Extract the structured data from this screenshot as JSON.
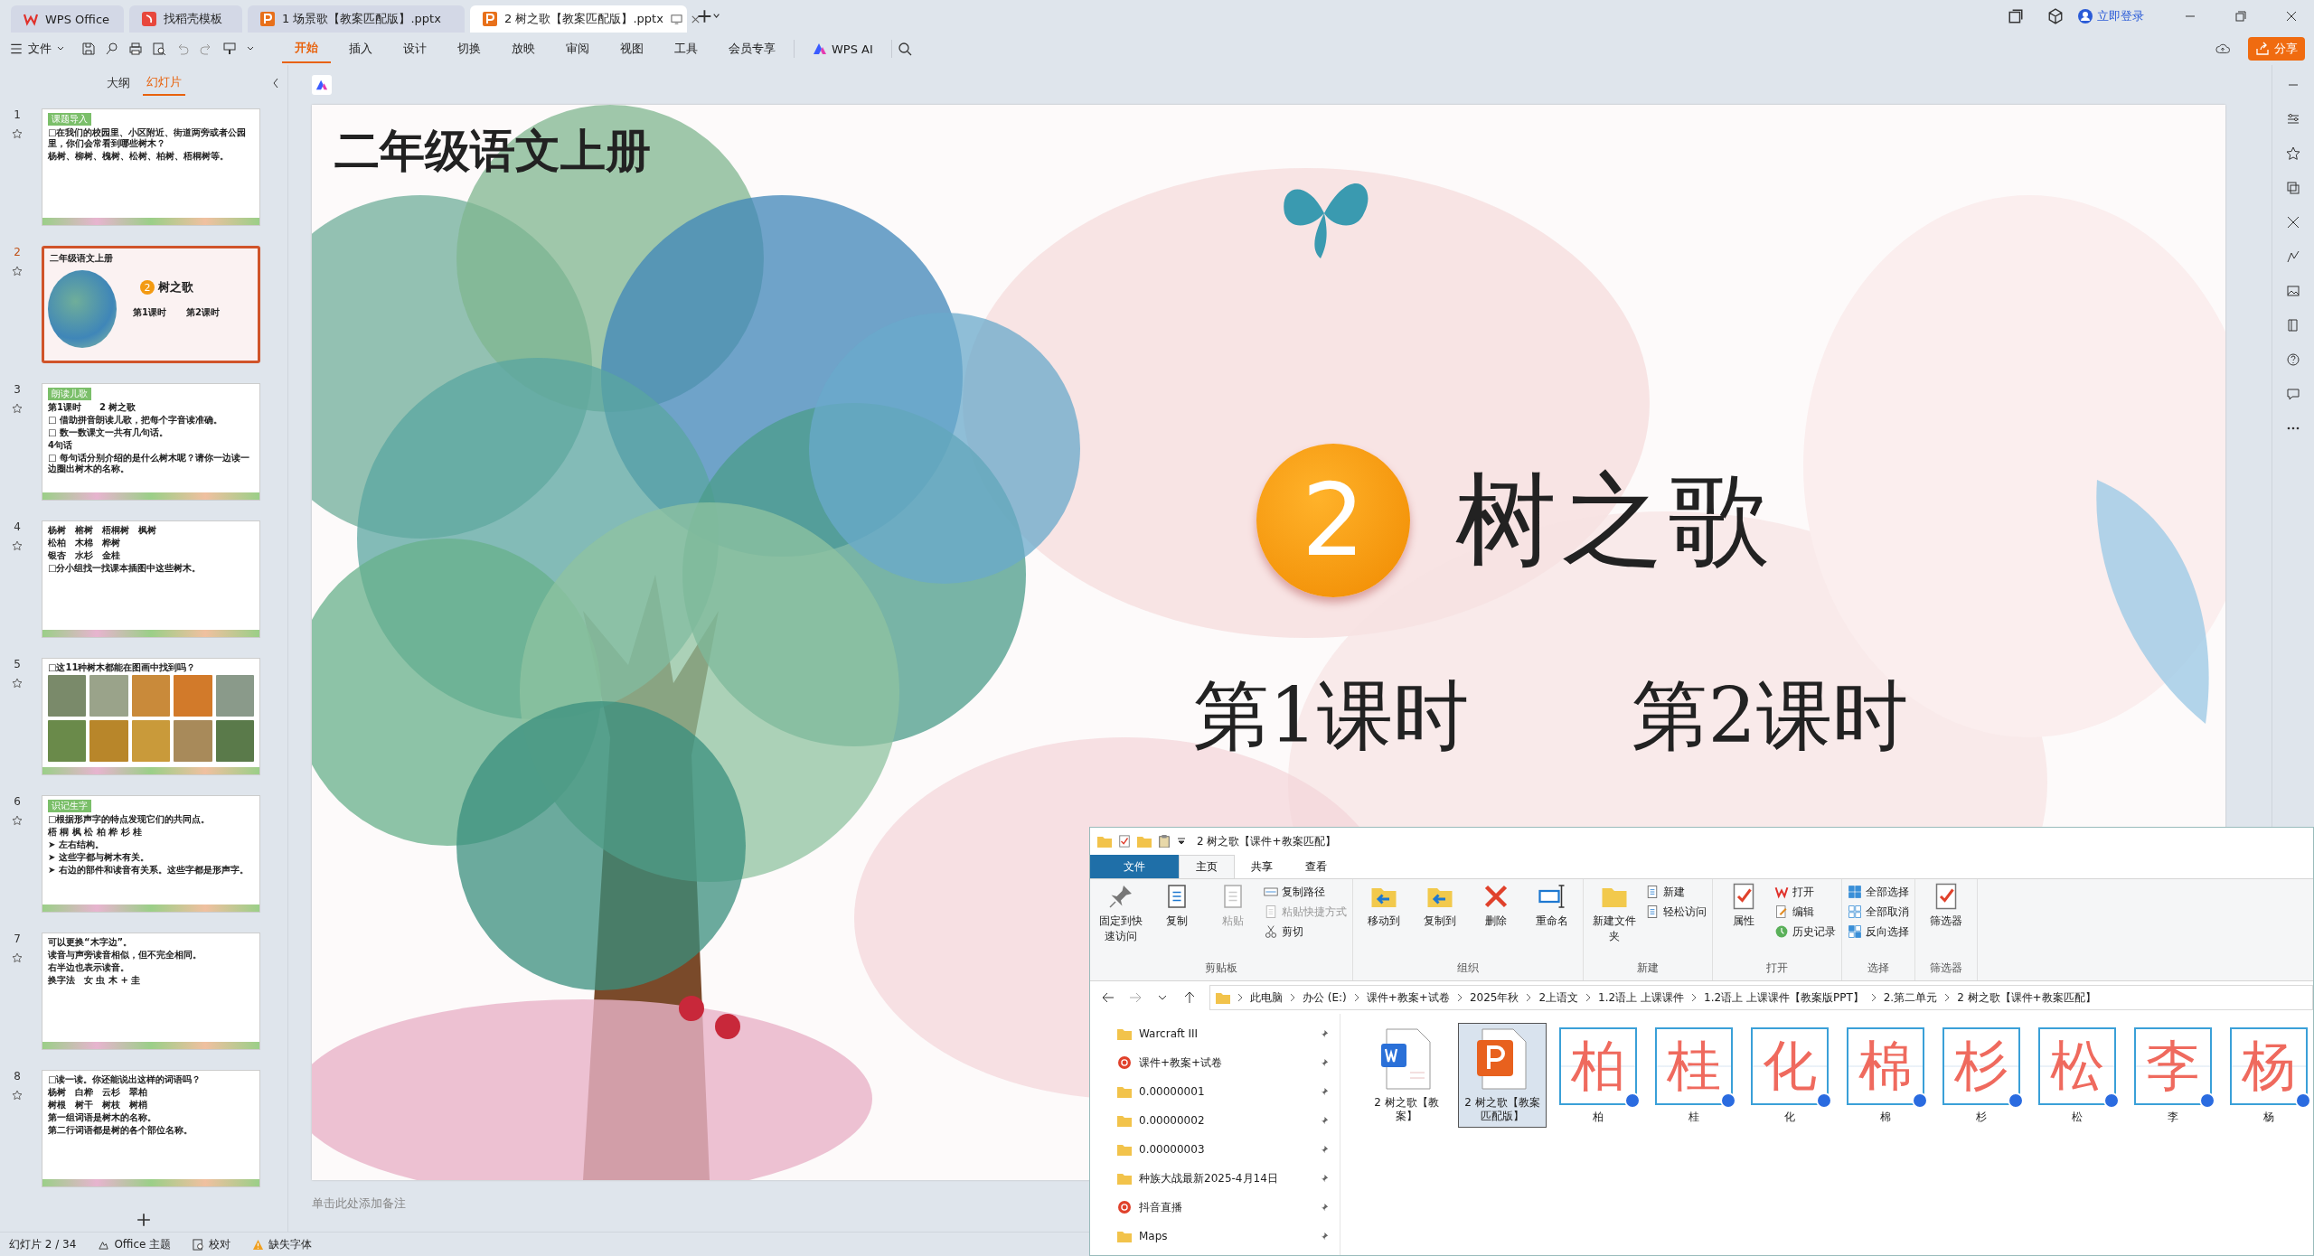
{
  "window_tabs": [
    {
      "label": "WPS Office",
      "kind": "home",
      "selected": false
    },
    {
      "label": "找稻壳模板",
      "kind": "template",
      "selected": false
    },
    {
      "label": "1 场景歌【教案匹配版】.pptx",
      "kind": "doc",
      "selected": false
    },
    {
      "label": "2 树之歌【教案匹配版】.pptx",
      "kind": "doc",
      "selected": true
    }
  ],
  "login": "立即登录",
  "menu": {
    "file": "文件",
    "tabs": [
      {
        "label": "开始",
        "selected": true
      },
      {
        "label": "插入",
        "selected": false
      },
      {
        "label": "设计",
        "selected": false
      },
      {
        "label": "切换",
        "selected": false
      },
      {
        "label": "放映",
        "selected": false
      },
      {
        "label": "审阅",
        "selected": false
      },
      {
        "label": "视图",
        "selected": false
      },
      {
        "label": "工具",
        "selected": false
      },
      {
        "label": "会员专享",
        "selected": false
      }
    ],
    "ai": "WPS AI",
    "share": "分享"
  },
  "panel_tabs": [
    {
      "label": "大纲",
      "selected": false
    },
    {
      "label": "幻灯片",
      "selected": true
    }
  ],
  "thumbnails": [
    {
      "number": "1",
      "kind": "text",
      "selected": false,
      "tag": "课题导入",
      "lines": [
        "□在我们的校园里、小区附近、街道两旁或者公园里，你们会常看到哪些树木？",
        "杨树、柳树、槐树、松树、柏树、梧桐树等。"
      ]
    },
    {
      "number": "2",
      "kind": "title",
      "selected": true,
      "lines": [
        "二年级语文上册",
        "2",
        "树之歌",
        "第1课时",
        "第2课时"
      ]
    },
    {
      "number": "3",
      "kind": "text",
      "selected": false,
      "tag": "朗读儿歌",
      "lines": [
        "第1课时　　2 树之歌",
        "□ 借助拼音朗读儿歌，把每个字音读准确。",
        "□ 数一数课文一共有几句话。",
        "4句话",
        "□ 每句话分别介绍的是什么树木呢？请你一边读一边圈出树木的名称。"
      ]
    },
    {
      "number": "4",
      "kind": "text",
      "selected": false,
      "lines": [
        "杨树　榕树　梧桐树　枫树",
        "松柏　木棉　桦树",
        "银杏　水杉　金桂",
        "□分小组找一找课本插图中这些树木。"
      ]
    },
    {
      "number": "5",
      "kind": "photos",
      "selected": false,
      "lines": [
        "□这11种树木都能在图画中找到吗？"
      ]
    },
    {
      "number": "6",
      "kind": "text",
      "selected": false,
      "tag": "识记生字",
      "lines": [
        "□根据形声字的特点发现它们的共同点。",
        "梧 桐 枫 松 柏 桦 杉 桂",
        "➤ 左右结构。",
        "➤ 这些字都与树木有关。",
        "➤ 右边的部件和读音有关系。这些字都是形声字。"
      ]
    },
    {
      "number": "7",
      "kind": "text",
      "selected": false,
      "lines": [
        "可以更换“木字边”。",
        "读音与声旁读音相似，但不完全相同。",
        "右半边也表示读音。",
        "换字法　女 虫 木 + 圭"
      ]
    },
    {
      "number": "8",
      "kind": "text",
      "selected": false,
      "lines": [
        "□读一读。你还能说出这样的词语吗？",
        "杨树　白桦　云杉　翠柏",
        "树根　树干　树枝　树梢",
        "第一组词语是树木的名称。",
        "第二行词语都是树的各个部位名称。"
      ]
    }
  ],
  "slide": {
    "subtitle": "二年级语文上册",
    "number": "2",
    "title": "树之歌",
    "lessons": [
      "第1课时",
      "第2课时"
    ]
  },
  "notes_placeholder": "单击此处添加备注",
  "status_bar": {
    "slide": "幻灯片 2 / 34",
    "theme": "Office 主题",
    "proof": "校对",
    "fonts": "缺失字体"
  },
  "explorer": {
    "title": "2 树之歌【课件+教案匹配】",
    "tabs": [
      {
        "label": "文件",
        "kind": "file",
        "selected": false
      },
      {
        "label": "主页",
        "kind": "tab",
        "selected": true
      },
      {
        "label": "共享",
        "kind": "tab",
        "selected": false
      },
      {
        "label": "查看",
        "kind": "tab",
        "selected": false
      }
    ],
    "groups": [
      {
        "name": "剪贴板",
        "items": [
          {
            "label": "固定到快速访问",
            "kind": "big",
            "disabled": false
          },
          {
            "label": "复制",
            "kind": "big",
            "disabled": false
          },
          {
            "label": "粘贴",
            "kind": "big",
            "disabled": true
          },
          {
            "label": "复制路径",
            "kind": "small",
            "disabled": false
          },
          {
            "label": "粘贴快捷方式",
            "kind": "small",
            "disabled": true
          },
          {
            "label": "剪切",
            "kind": "small",
            "disabled": false
          }
        ]
      },
      {
        "name": "组织",
        "items": [
          {
            "label": "移动到",
            "kind": "big",
            "disabled": false
          },
          {
            "label": "复制到",
            "kind": "big",
            "disabled": false
          },
          {
            "label": "删除",
            "kind": "big",
            "disabled": false
          },
          {
            "label": "重命名",
            "kind": "big",
            "disabled": false
          }
        ]
      },
      {
        "name": "新建",
        "items": [
          {
            "label": "新建文件夹",
            "kind": "big",
            "disabled": false
          },
          {
            "label": "新建",
            "kind": "small",
            "disabled": false
          },
          {
            "label": "轻松访问",
            "kind": "small",
            "disabled": false
          }
        ]
      },
      {
        "name": "打开",
        "items": [
          {
            "label": "属性",
            "kind": "big",
            "disabled": false
          },
          {
            "label": "打开",
            "kind": "small",
            "disabled": false
          },
          {
            "label": "编辑",
            "kind": "small",
            "disabled": false
          },
          {
            "label": "历史记录",
            "kind": "small",
            "disabled": false
          }
        ]
      },
      {
        "name": "选择",
        "items": [
          {
            "label": "全部选择",
            "kind": "small",
            "disabled": false
          },
          {
            "label": "全部取消",
            "kind": "small",
            "disabled": false
          },
          {
            "label": "反向选择",
            "kind": "small",
            "disabled": false
          }
        ]
      },
      {
        "name": "筛选器",
        "items": [
          {
            "label": "筛选器",
            "kind": "big",
            "disabled": false
          }
        ]
      }
    ],
    "breadcrumb": [
      "此电脑",
      "办公 (E:)",
      "课件+教案+试卷",
      "2025年秋",
      "2上语文",
      "1.2语上 上课课件",
      "1.2语上 上课课件【教案版PPT】",
      "2.第二单元",
      "2 树之歌【课件+教案匹配】"
    ],
    "nav": [
      {
        "label": "Warcraft III",
        "kind": "folder"
      },
      {
        "label": "课件+教案+试卷",
        "kind": "app"
      },
      {
        "label": "0.00000001",
        "kind": "folder"
      },
      {
        "label": "0.00000002",
        "kind": "folder"
      },
      {
        "label": "0.00000003",
        "kind": "folder"
      },
      {
        "label": "种族大战最新2025-4月14日",
        "kind": "folder"
      },
      {
        "label": "抖音直播",
        "kind": "app"
      },
      {
        "label": "Maps",
        "kind": "folder"
      }
    ],
    "files": [
      {
        "label": "2 树之歌【教案】",
        "kind": "word",
        "selected": false
      },
      {
        "label": "2 树之歌【教案匹配版】",
        "kind": "ppt",
        "selected": true
      },
      {
        "label": "柏",
        "kind": "char",
        "char": "柏",
        "selected": false
      },
      {
        "label": "桂",
        "kind": "char",
        "char": "桂",
        "selected": false
      },
      {
        "label": "化",
        "kind": "char",
        "char": "化",
        "selected": false
      },
      {
        "label": "棉",
        "kind": "char",
        "char": "棉",
        "selected": false
      },
      {
        "label": "杉",
        "kind": "char",
        "char": "杉",
        "selected": false
      },
      {
        "label": "松",
        "kind": "char",
        "char": "松",
        "selected": false
      },
      {
        "label": "李",
        "kind": "char",
        "char": "李",
        "selected": false
      },
      {
        "label": "杨",
        "kind": "char",
        "char": "杨",
        "selected": false
      }
    ]
  }
}
